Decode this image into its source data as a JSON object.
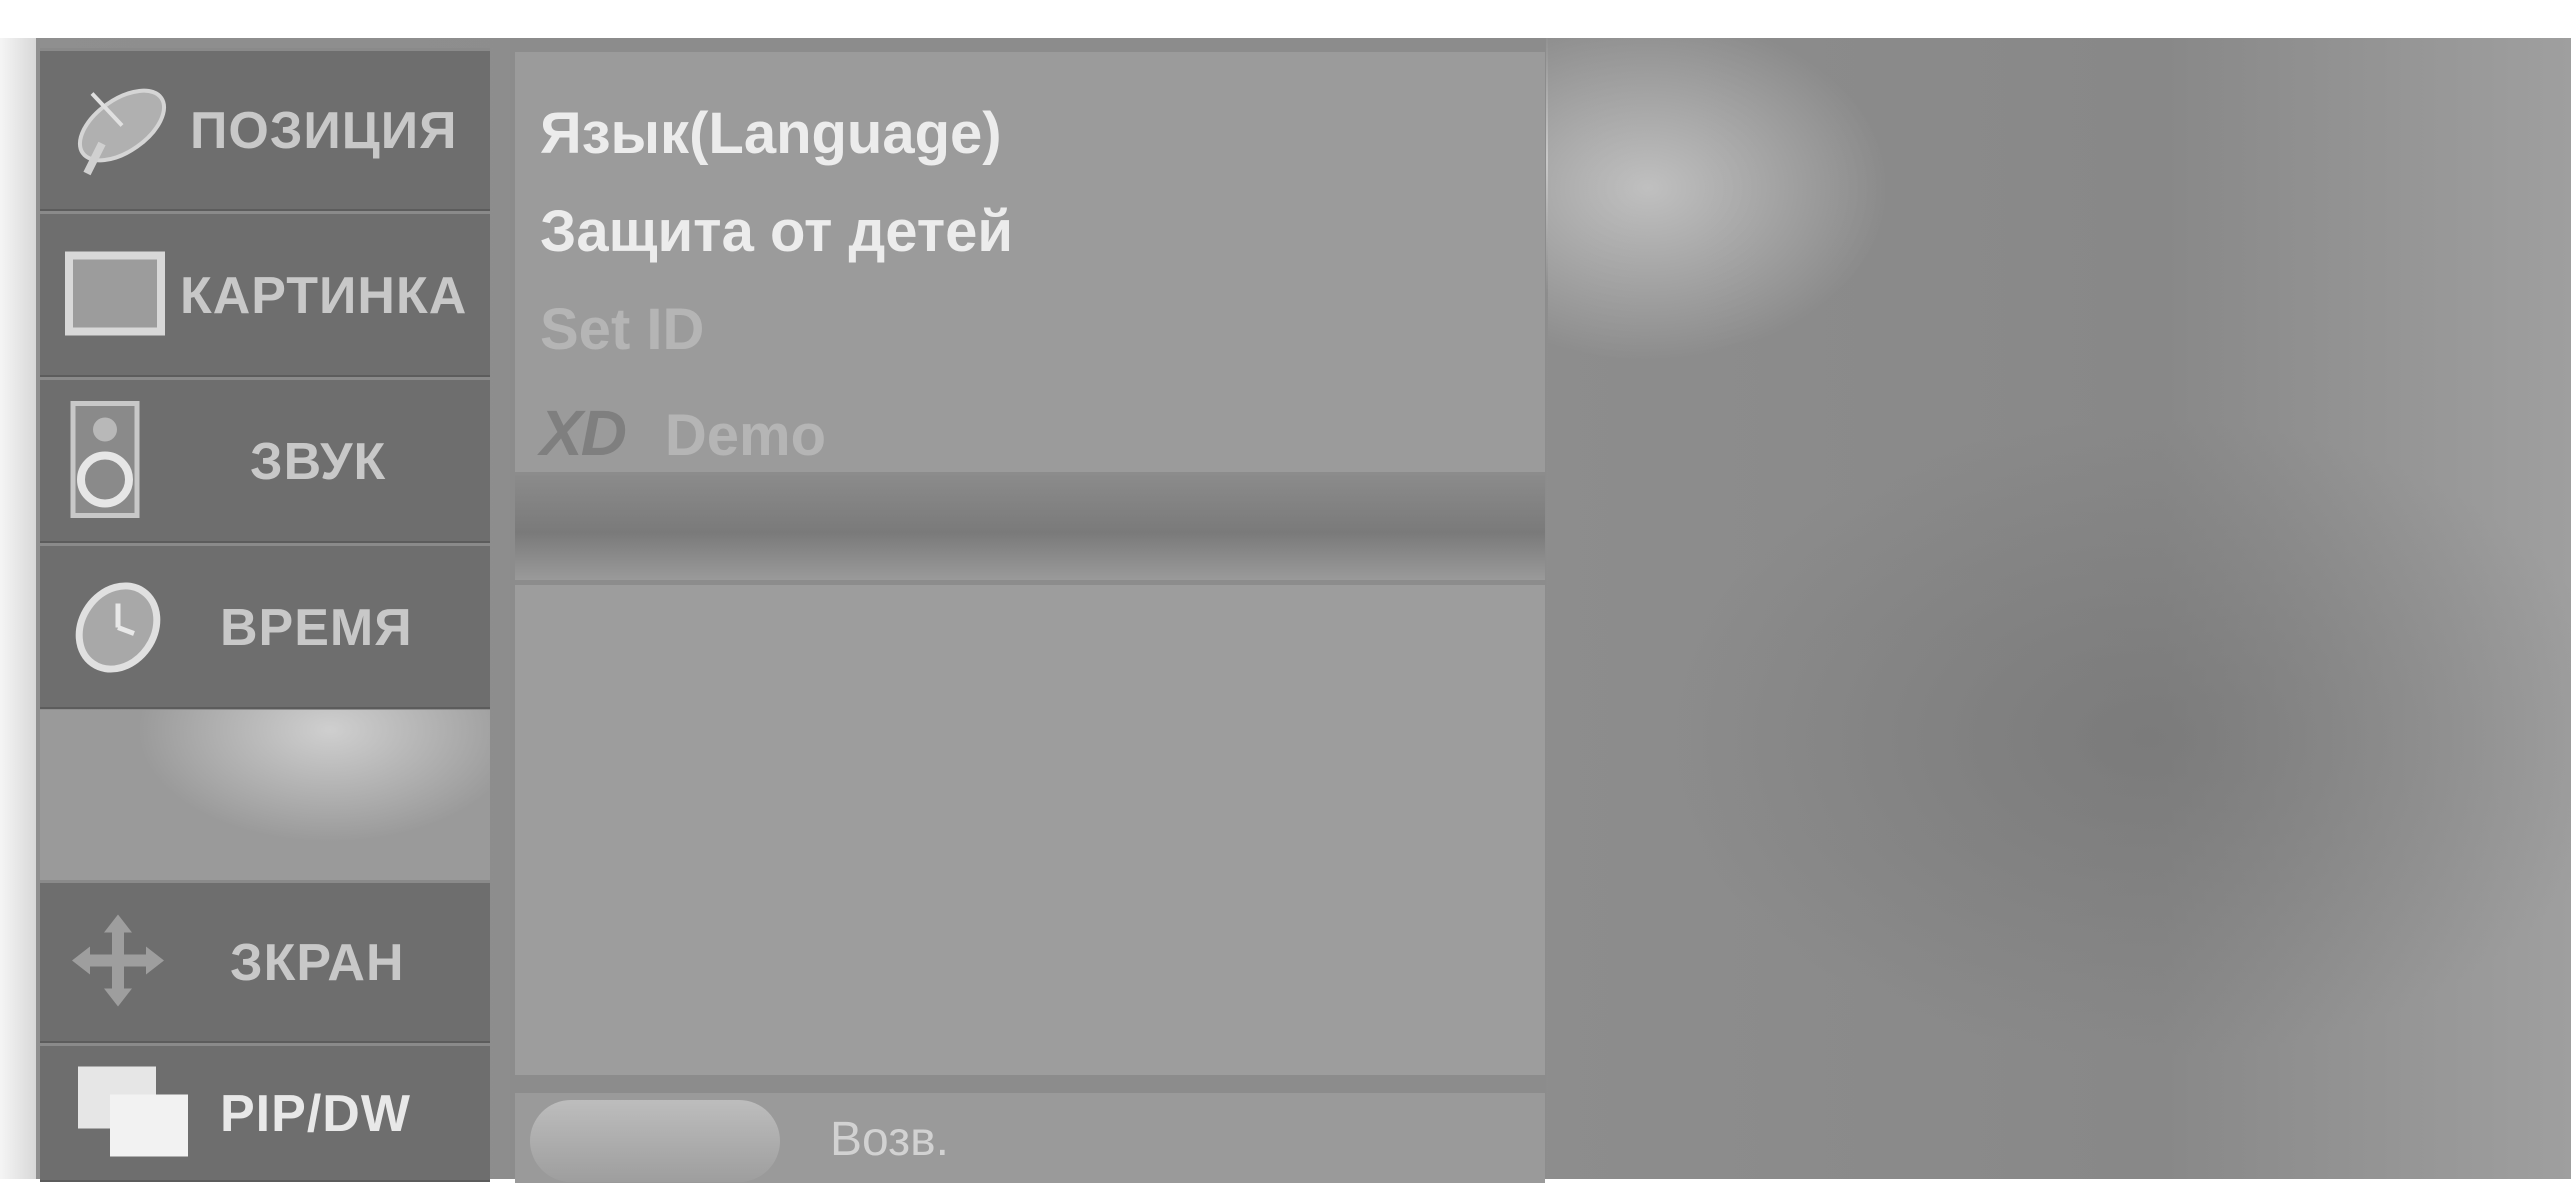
{
  "sidebar": {
    "items": [
      {
        "label": "ПОЗИЦИЯ",
        "icon": "satellite-dish-icon"
      },
      {
        "label": "КАРТИНКА",
        "icon": "picture-icon"
      },
      {
        "label": "ЗВУК",
        "icon": "speaker-icon"
      },
      {
        "label": "ВРЕМЯ",
        "icon": "clock-icon"
      },
      {
        "label": "ЗКРАН",
        "icon": "move-arrows-icon"
      },
      {
        "label": "PIP/DW",
        "icon": "pip-windows-icon"
      }
    ]
  },
  "menu": {
    "items": [
      {
        "label": "Язык(Language)",
        "state": "enabled"
      },
      {
        "label": "Защита от детей",
        "state": "enabled"
      },
      {
        "label": "Set ID",
        "state": "disabled"
      },
      {
        "label": "Demo",
        "logo": "XD",
        "state": "disabled"
      }
    ]
  },
  "footer": {
    "back_label": "Возв."
  },
  "colors": {
    "panel": "#9b9b9b",
    "sidebar": "#6e6e6e",
    "text_enabled": "#ececec",
    "text_disabled": "#b5b5b5"
  }
}
